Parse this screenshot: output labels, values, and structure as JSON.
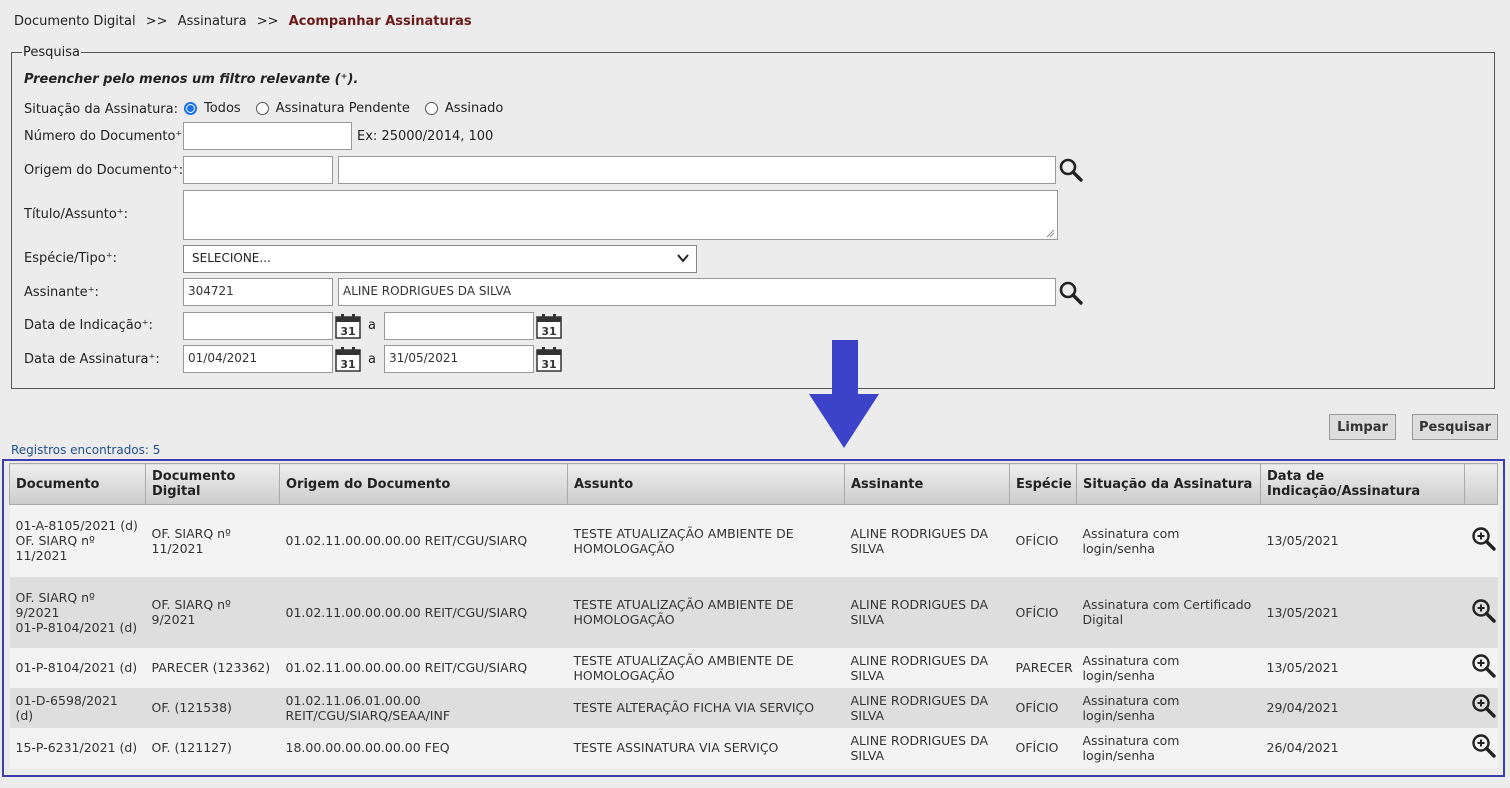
{
  "breadcrumb": {
    "items": [
      "Documento Digital",
      "Assinatura"
    ],
    "separator": ">>",
    "current": "Acompanhar Assinaturas"
  },
  "search": {
    "legend": "Pesquisa",
    "hint": "Preencher pelo menos um filtro relevante (⁺).",
    "situacao_label": "Situação da Assinatura:",
    "situacao_options": [
      {
        "label": "Todos",
        "checked": true
      },
      {
        "label": "Assinatura Pendente",
        "checked": false
      },
      {
        "label": "Assinado",
        "checked": false
      }
    ],
    "numero_label": "Número do Documento⁺:",
    "numero_value": "",
    "numero_example": "Ex: 25000/2014, 100",
    "origem_label": "Origem do Documento⁺:",
    "origem_code": "",
    "origem_desc": "",
    "titulo_label": "Título/Assunto⁺:",
    "titulo_value": "",
    "especie_label": "Espécie/Tipo⁺:",
    "especie_value": "SELECIONE...",
    "assinante_label": "Assinante⁺:",
    "assinante_code": "304721",
    "assinante_name": "ALINE RODRIGUES DA SILVA",
    "data_indicacao_label": "Data de Indicação⁺:",
    "data_indicacao_from": "",
    "data_indicacao_to": "",
    "data_assinatura_label": "Data de Assinatura⁺:",
    "data_assinatura_from": "01/04/2021",
    "data_assinatura_to": "31/05/2021",
    "range_sep": "a",
    "calendar_day": "31"
  },
  "buttons": {
    "clear": "Limpar",
    "search": "Pesquisar"
  },
  "results": {
    "count_text": "Registros encontrados: 5",
    "columns": [
      "Documento",
      "Documento Digital",
      "Origem do Documento",
      "Assunto",
      "Assinante",
      "Espécie",
      "Situação da Assinatura",
      "Data de Indicação/Assinatura",
      ""
    ],
    "rows": [
      [
        "01-A-8105/2021 (d)\nOF. SIARQ nº 11/2021",
        "OF. SIARQ nº 11/2021",
        "01.02.11.00.00.00.00 REIT/CGU/SIARQ",
        "TESTE ATUALIZAÇÃO AMBIENTE DE HOMOLOGAÇÃO",
        "ALINE RODRIGUES DA SILVA",
        "OFÍCIO",
        "Assinatura com login/senha",
        "13/05/2021"
      ],
      [
        "OF. SIARQ nº 9/2021\n01-P-8104/2021 (d)",
        "OF. SIARQ nº 9/2021",
        "01.02.11.00.00.00.00 REIT/CGU/SIARQ",
        "TESTE ATUALIZAÇÃO AMBIENTE DE HOMOLOGAÇÃO",
        "ALINE RODRIGUES DA SILVA",
        "OFÍCIO",
        "Assinatura com Certificado Digital",
        "13/05/2021"
      ],
      [
        "01-P-8104/2021 (d)",
        "PARECER (123362)",
        "01.02.11.00.00.00.00 REIT/CGU/SIARQ",
        "TESTE ATUALIZAÇÃO AMBIENTE DE HOMOLOGAÇÃO",
        "ALINE RODRIGUES DA SILVA",
        "PARECER",
        "Assinatura com login/senha",
        "13/05/2021"
      ],
      [
        "01-D-6598/2021 (d)",
        "OF. (121538)",
        "01.02.11.06.01.00.00 REIT/CGU/SIARQ/SEAA/INF",
        "TESTE ALTERAÇÃO FICHA VIA SERVIÇO",
        "ALINE RODRIGUES DA SILVA",
        "OFÍCIO",
        "Assinatura com login/senha",
        "29/04/2021"
      ],
      [
        "15-P-6231/2021 (d)",
        "OF. (121127)",
        "18.00.00.00.00.00.00 FEQ",
        "TESTE ASSINATURA VIA SERVIÇO",
        "ALINE RODRIGUES DA SILVA",
        "OFÍCIO",
        "Assinatura com login/senha",
        "26/04/2021"
      ]
    ]
  },
  "colors": {
    "arrow": "#3d43c9",
    "results_border": "#3b3fb0",
    "breadcrumb_current": "#6b1a1a",
    "radio_checked": "#1a73e8"
  }
}
